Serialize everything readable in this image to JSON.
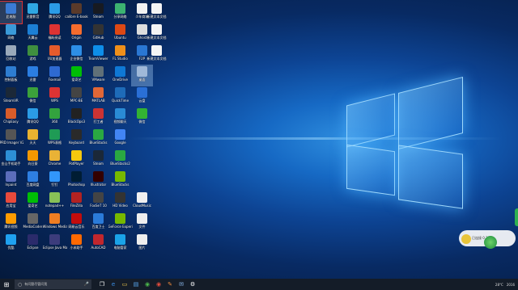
{
  "desktop": {
    "icons": [
      {
        "label": "此电脑",
        "color": "#3a7bd5",
        "col": 0,
        "row": 0,
        "selected": true
      },
      {
        "label": "网络",
        "color": "#3a9ad9",
        "col": 0,
        "row": 1
      },
      {
        "label": "回收站",
        "color": "#9aa9ba",
        "col": 0,
        "row": 2
      },
      {
        "label": "控制面板",
        "color": "#2e7dd1",
        "col": 0,
        "row": 3
      },
      {
        "label": "SteamVR",
        "color": "#1b2838",
        "col": 0,
        "row": 4
      },
      {
        "label": "ChipEasy",
        "color": "#d85c2a",
        "col": 0,
        "row": 5
      },
      {
        "label": "IPRD Imager V2...",
        "color": "#555555",
        "col": 0,
        "row": 6
      },
      {
        "label": "金山手机助手",
        "color": "#2d8fd5",
        "col": 0,
        "row": 7
      },
      {
        "label": "Inpaint",
        "color": "#5b6dbb",
        "col": 0,
        "row": 8
      },
      {
        "label": "应用宝",
        "color": "#e84a3c",
        "col": 0,
        "row": 9
      },
      {
        "label": "腾讯视频",
        "color": "#ff9c00",
        "col": 0,
        "row": 10
      },
      {
        "label": "优酷",
        "color": "#1fa1f0",
        "col": 0,
        "row": 11
      },
      {
        "label": "迅雷影音",
        "color": "#2fa7e2",
        "col": 1,
        "row": 0
      },
      {
        "label": "天翼云",
        "color": "#1c7fd4",
        "col": 1,
        "row": 1
      },
      {
        "label": "游戏",
        "color": "#3f8f3f",
        "col": 1,
        "row": 2
      },
      {
        "label": "迅雷",
        "color": "#2b7ee2",
        "col": 1,
        "row": 3
      },
      {
        "label": "微信",
        "color": "#3ba13b",
        "col": 1,
        "row": 4
      },
      {
        "label": "腾讯QQ",
        "color": "#2b9ce6",
        "col": 1,
        "row": 5
      },
      {
        "label": "天天",
        "color": "#e8b230",
        "col": 1,
        "row": 6
      },
      {
        "label": "向日葵",
        "color": "#f39800",
        "col": 1,
        "row": 7
      },
      {
        "label": "百度网盘",
        "color": "#2e7fe2",
        "col": 1,
        "row": 8
      },
      {
        "label": "爱奇艺",
        "color": "#00be06",
        "col": 1,
        "row": 9
      },
      {
        "label": "MediaCoder",
        "color": "#666666",
        "col": 1,
        "row": 10
      },
      {
        "label": "Eclipse",
        "color": "#2b2b6b",
        "col": 1,
        "row": 11
      },
      {
        "label": "腾讯QQ",
        "color": "#2b9ce6",
        "col": 2,
        "row": 0
      },
      {
        "label": "福昕阅读",
        "color": "#d33",
        "col": 2,
        "row": 1
      },
      {
        "label": "UU加速器",
        "color": "#e55b2b",
        "col": 2,
        "row": 2
      },
      {
        "label": "Foxmail",
        "color": "#2e6ad1",
        "col": 2,
        "row": 3
      },
      {
        "label": "WPS",
        "color": "#d33",
        "col": 2,
        "row": 4
      },
      {
        "label": "360",
        "color": "#33a33e",
        "col": 2,
        "row": 5
      },
      {
        "label": "WPS表格",
        "color": "#1f9b55",
        "col": 2,
        "row": 6
      },
      {
        "label": "Chrome",
        "color": "#e9b236",
        "col": 2,
        "row": 7
      },
      {
        "label": "钉钉",
        "color": "#3296fa",
        "col": 2,
        "row": 8
      },
      {
        "label": "notepad++",
        "color": "#88c057",
        "col": 2,
        "row": 9
      },
      {
        "label": "Windows Media Pla...",
        "color": "#ef7d22",
        "col": 2,
        "row": 10
      },
      {
        "label": "Eclipse Java Mars",
        "color": "#3c3c7c",
        "col": 2,
        "row": 11
      },
      {
        "label": "calibre E-book",
        "color": "#5a3a2a",
        "col": 3,
        "row": 0
      },
      {
        "label": "Origin",
        "color": "#f56c2d",
        "col": 3,
        "row": 1
      },
      {
        "label": "企业微信",
        "color": "#2d8ee6",
        "col": 3,
        "row": 2
      },
      {
        "label": "爱奇艺",
        "color": "#00be06",
        "col": 3,
        "row": 3
      },
      {
        "label": "MPC-BE",
        "color": "#444444",
        "col": 3,
        "row": 4
      },
      {
        "label": "BlackOps3",
        "color": "#222222",
        "col": 3,
        "row": 5
      },
      {
        "label": "Keyboard",
        "color": "#2a2a2a",
        "col": 3,
        "row": 6
      },
      {
        "label": "PotPlayer",
        "color": "#f6c90e",
        "col": 3,
        "row": 7
      },
      {
        "label": "Photoshop",
        "color": "#001d34",
        "col": 3,
        "row": 8
      },
      {
        "label": "FileZilla",
        "color": "#b22222",
        "col": 3,
        "row": 9
      },
      {
        "label": "网易云音乐",
        "color": "#c20c0c",
        "col": 3,
        "row": 10
      },
      {
        "label": "小米助手",
        "color": "#ff6900",
        "col": 3,
        "row": 11
      },
      {
        "label": "Steam",
        "color": "#171a21",
        "col": 4,
        "row": 0
      },
      {
        "label": "GitHub",
        "color": "#333333",
        "col": 4,
        "row": 1
      },
      {
        "label": "TeamViewer",
        "color": "#0e8ee9",
        "col": 4,
        "row": 2
      },
      {
        "label": "VMware",
        "color": "#607078",
        "col": 4,
        "row": 3
      },
      {
        "label": "MATLAB",
        "color": "#e16737",
        "col": 4,
        "row": 4
      },
      {
        "label": "打工者",
        "color": "#cc3333",
        "col": 4,
        "row": 5
      },
      {
        "label": "BlueStacks",
        "color": "#2aa842",
        "col": 4,
        "row": 6
      },
      {
        "label": "Steam",
        "color": "#1b2838",
        "col": 4,
        "row": 7
      },
      {
        "label": "Illustrator",
        "color": "#330000",
        "col": 4,
        "row": 8
      },
      {
        "label": "FoxSeT 10",
        "color": "#444444",
        "col": 4,
        "row": 9
      },
      {
        "label": "百度卫士",
        "color": "#2b7bd9",
        "col": 4,
        "row": 10
      },
      {
        "label": "AutoCAD",
        "color": "#c1272d",
        "col": 4,
        "row": 11
      },
      {
        "label": "分享网络",
        "color": "#3cb371",
        "col": 5,
        "row": 0
      },
      {
        "label": "Ubuntu",
        "color": "#dd4814",
        "col": 5,
        "row": 1
      },
      {
        "label": "FL Studio",
        "color": "#ef8f1a",
        "col": 5,
        "row": 2
      },
      {
        "label": "OneDrive",
        "color": "#0f78d4",
        "col": 5,
        "row": 3
      },
      {
        "label": "QuickTime",
        "color": "#1e6bb8",
        "col": 5,
        "row": 4
      },
      {
        "label": "视频聊天",
        "color": "#2a8bd5",
        "col": 5,
        "row": 5
      },
      {
        "label": "Google",
        "color": "#4285f4",
        "col": 5,
        "row": 6
      },
      {
        "label": "BlueStacks2",
        "color": "#2aa842",
        "col": 5,
        "row": 7
      },
      {
        "label": "BlueStacks",
        "color": "#76b900",
        "col": 5,
        "row": 8
      },
      {
        "label": "HD Video",
        "color": "#333333",
        "col": 5,
        "row": 9
      },
      {
        "label": "GeForce Experience",
        "color": "#76b900",
        "col": 5,
        "row": 10
      },
      {
        "label": "电脑管家",
        "color": "#1aa3e8",
        "col": 5,
        "row": 11
      },
      {
        "label": "少年商城",
        "color": "#f2f2f2",
        "col": 6,
        "row": 0
      },
      {
        "label": "Ghost",
        "color": "#dddddd",
        "col": 6,
        "row": 1
      },
      {
        "label": "F2P",
        "color": "#2a77d3",
        "col": 6,
        "row": 2
      },
      {
        "label": "桌面",
        "color": "#9fb8d8",
        "col": 6,
        "row": 3,
        "highlight": true
      },
      {
        "label": "云盘",
        "color": "#2a6fd6",
        "col": 6,
        "row": 4
      },
      {
        "label": "微信",
        "color": "#33b233",
        "col": 6,
        "row": 5
      },
      {
        "label": "CloudMusic",
        "color": "#f0f0f0",
        "col": 6,
        "row": 9
      },
      {
        "label": "文件",
        "color": "#eeeeee",
        "col": 6,
        "row": 10
      },
      {
        "label": "图片",
        "color": "#eeeeee",
        "col": 6,
        "row": 11
      }
    ],
    "right_icons": [
      {
        "label": "新建文本文档",
        "color": "#f4f4f4"
      },
      {
        "label": "新建文本文档",
        "color": "#f4f4f4"
      },
      {
        "label": "新建文本文档",
        "color": "#f4f4f4"
      }
    ]
  },
  "widget": {
    "label": "已连接 0.2%"
  },
  "taskbar": {
    "start_glyph": "⊞",
    "search_placeholder": "有问题尽管问我",
    "search_glyph": "○",
    "mic_glyph": "🎤",
    "pinned": [
      {
        "name": "task-view-icon",
        "glyph": "❐",
        "color": "#ffffff"
      },
      {
        "name": "edge-icon",
        "glyph": "e",
        "color": "#3a8ee6"
      },
      {
        "name": "explorer-icon",
        "glyph": "▭",
        "color": "#f2c94c"
      },
      {
        "name": "store-icon",
        "glyph": "▤",
        "color": "#5aa9f0"
      },
      {
        "name": "app-green-icon",
        "glyph": "◉",
        "color": "#4cb84c"
      },
      {
        "name": "app-red-icon",
        "glyph": "◉",
        "color": "#e34c3c"
      },
      {
        "name": "app-pen-icon",
        "glyph": "✎",
        "color": "#f08b3c"
      },
      {
        "name": "app-mail-icon",
        "glyph": "✉",
        "color": "#8fbdf0"
      },
      {
        "name": "settings-icon",
        "glyph": "⚙",
        "color": "#ffffff"
      }
    ],
    "tray_temp": "28°C",
    "tray_time": "2016"
  }
}
